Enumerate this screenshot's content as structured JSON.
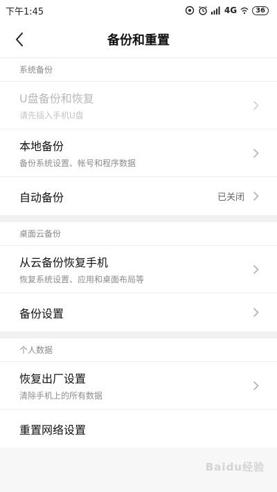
{
  "status_bar": {
    "time": "下午1:45",
    "network": "4G",
    "battery": "36",
    "icons": [
      "hotspot-icon",
      "alarm-icon",
      "signal-icon",
      "wifi-icon"
    ]
  },
  "header": {
    "title": "备份和重置",
    "back_icon": "chevron-left-icon"
  },
  "sections": [
    {
      "title": "系统备份",
      "items": [
        {
          "title": "U盘备份和恢复",
          "subtitle": "请先插入手机U盘",
          "value": "",
          "disabled": true
        },
        {
          "title": "本地备份",
          "subtitle": "备份系统设置、帐号和程序数据",
          "value": "",
          "disabled": false
        },
        {
          "title": "自动备份",
          "subtitle": "",
          "value": "已关闭",
          "disabled": false
        }
      ]
    },
    {
      "title": "桌面云备份",
      "items": [
        {
          "title": "从云备份恢复手机",
          "subtitle": "恢复系统设置、应用和桌面布局等",
          "value": "",
          "disabled": false
        },
        {
          "title": "备份设置",
          "subtitle": "",
          "value": "",
          "disabled": false
        }
      ]
    },
    {
      "title": "个人数据",
      "items": [
        {
          "title": "恢复出厂设置",
          "subtitle": "清除手机上的所有数据",
          "value": "",
          "disabled": false
        },
        {
          "title": "重置网络设置",
          "subtitle": "",
          "value": "",
          "disabled": false
        }
      ]
    }
  ],
  "watermark": "Baidu经验"
}
